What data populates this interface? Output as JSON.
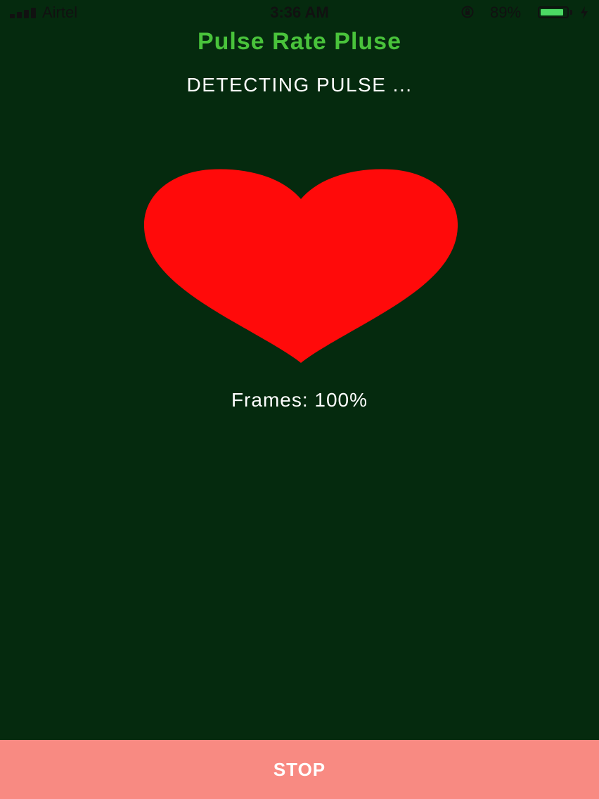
{
  "status_bar": {
    "carrier": "Airtel",
    "time": "3:36 AM",
    "battery_percent_text": "89%",
    "battery_level": 0.89,
    "battery_color": "#4cd964",
    "icons": [
      "signal-icon",
      "orientation-lock-icon",
      "battery-icon",
      "charging-bolt-icon"
    ]
  },
  "app": {
    "title": "Pulse Rate Pluse",
    "status": "DETECTING PULSE ...",
    "frames": "Frames: 100%",
    "heart_icon": "heart-icon",
    "heart_color": "#ff0a0a",
    "background_color": "#052a0e",
    "title_color": "#49c33b"
  },
  "footer": {
    "stop_label": "STOP",
    "button_color": "#f88a82"
  }
}
